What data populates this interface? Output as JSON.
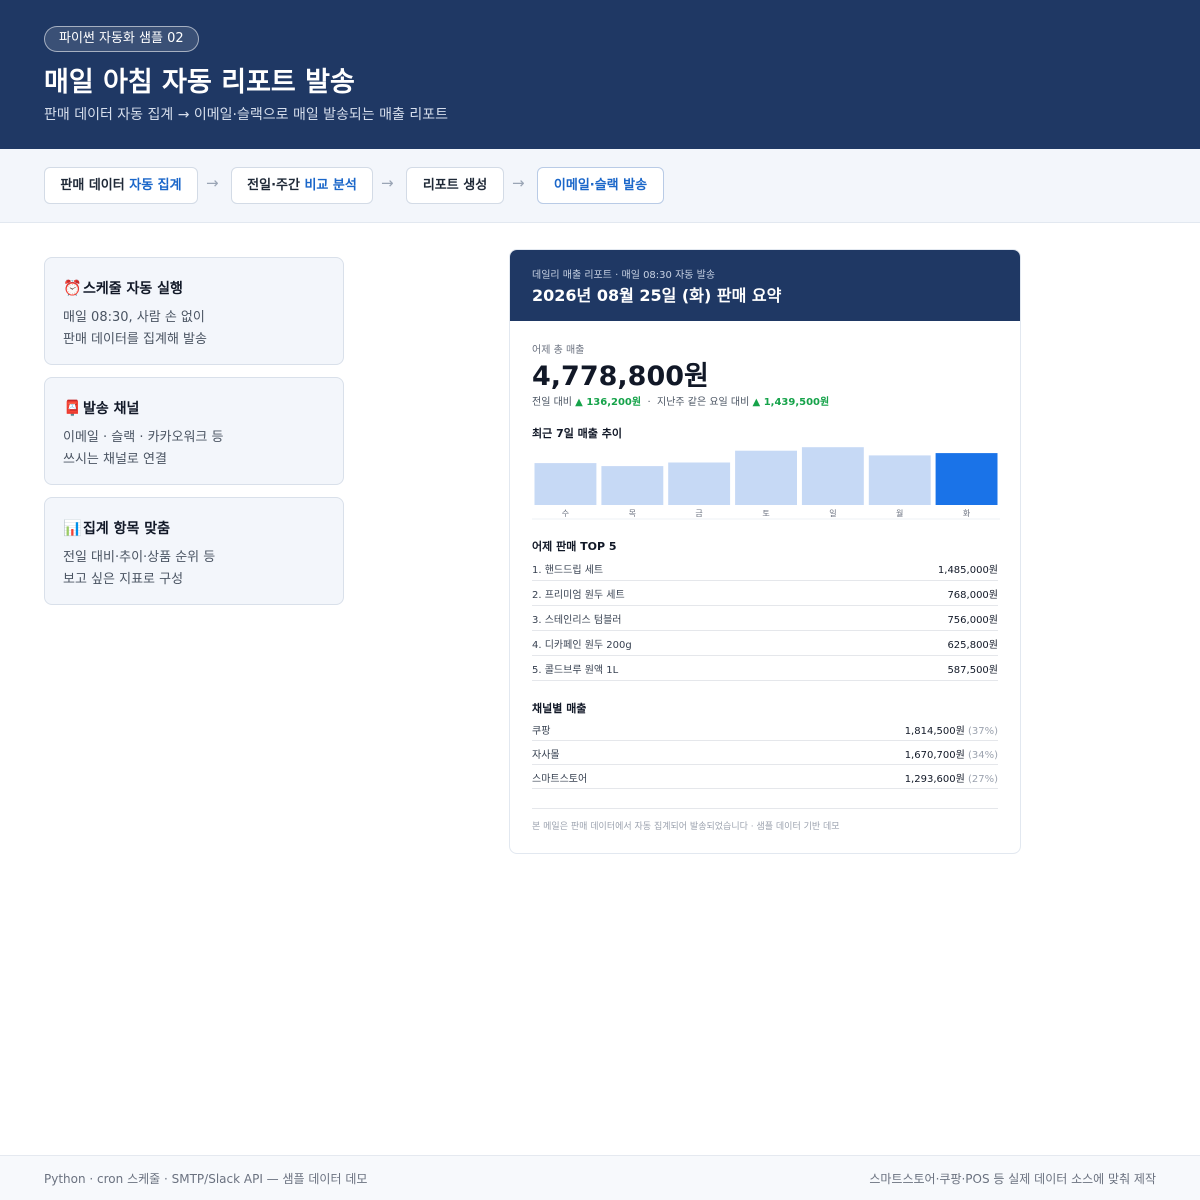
{
  "header": {
    "badge": "파이썬 자동화 샘플 02",
    "title": "매일 아침 자동 리포트 발송",
    "subtitle": "판매 데이터 자동 집계 → 이메일·슬랙으로 매일 발송되는 매출 리포트"
  },
  "steps": [
    {
      "pre": "판매 데이터 ",
      "hl": "자동 집계"
    },
    {
      "pre": "전일·주간 ",
      "hl": "비교 분석"
    },
    {
      "pre": "리포트 생성",
      "hl": ""
    },
    {
      "pre": "",
      "hl": "이메일·슬랙 발송"
    }
  ],
  "step_arrow": "→",
  "cards": [
    {
      "emoji": "⏰",
      "title": "스케줄 자동 실행",
      "line1": "매일 08:30, 사람 손 없이",
      "line2": "판매 데이터를 집계해 발송"
    },
    {
      "emoji": "📮",
      "title": "발송 채널",
      "line1": "이메일 · 슬랙 · 카카오워크 등",
      "line2": "쓰시는 채널로 연결"
    },
    {
      "emoji": "📊",
      "title": "집계 항목 맞춤",
      "line1": "전일 대비·추이·상품 순위 등",
      "line2": "보고 싶은 지표로 구성"
    }
  ],
  "report": {
    "caption": "데일리 매출 리포트 · 매일 08:30 자동 발송",
    "title": "2026년 08월 25일 (화) 판매 요약",
    "total_label": "어제 총 매출",
    "total": "4,778,800원",
    "compare": {
      "prev_label": "전일 대비",
      "prev_value": "▲ 136,200원",
      "sep": "·",
      "week_label": "지난주 같은 요일 대비",
      "week_value": "▲ 1,439,500원"
    },
    "trend_title": "최근 7일 매출 추이",
    "top_title": "어제 판매 TOP 5",
    "top": [
      {
        "name": "1. 핸드드립 세트",
        "amount": "1,485,000원"
      },
      {
        "name": "2. 프리미엄 원두 세트",
        "amount": "768,000원"
      },
      {
        "name": "3. 스테인리스 텀블러",
        "amount": "756,000원"
      },
      {
        "name": "4. 디카페인 원두 200g",
        "amount": "625,800원"
      },
      {
        "name": "5. 콜드브루 원액 1L",
        "amount": "587,500원"
      }
    ],
    "channel_title": "채널별 매출",
    "channels": [
      {
        "name": "쿠팡",
        "amount": "1,814,500원",
        "pct": "(37%)"
      },
      {
        "name": "자사몰",
        "amount": "1,670,700원",
        "pct": "(34%)"
      },
      {
        "name": "스마트스토어",
        "amount": "1,293,600원",
        "pct": "(27%)"
      }
    ],
    "footnote": "본 메일은 판매 데이터에서 자동 집계되어 발송되었습니다 · 샘플 데이터 기반 데모"
  },
  "chart_data": {
    "type": "bar",
    "categories": [
      "수",
      "목",
      "금",
      "토",
      "일",
      "월",
      "화"
    ],
    "values": [
      3.55,
      3.3,
      3.6,
      4.6,
      4.9,
      4.2,
      4.4
    ],
    "ylim": [
      0,
      5
    ],
    "colors": {
      "default": "#c6d9f5",
      "highlight": "#1a73e8"
    },
    "highlight_index": 6
  },
  "footer": {
    "left": "Python · cron 스케줄 · SMTP/Slack API — 샘플 데이터 데모",
    "right": "스마트스토어·쿠팡·POS 등 실제 데이터 소스에 맞춰 제작"
  }
}
